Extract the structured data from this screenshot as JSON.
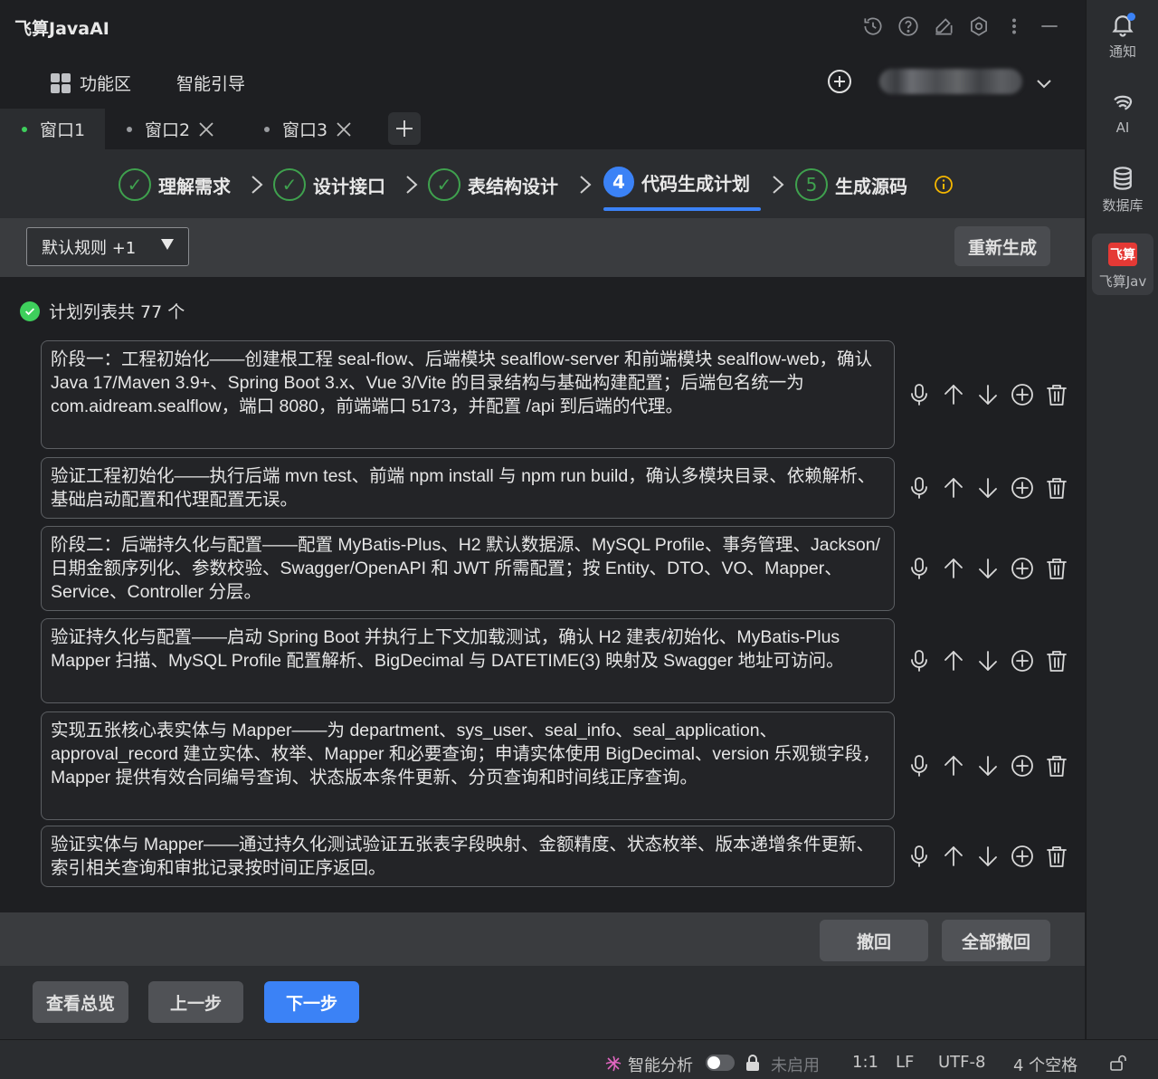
{
  "app": {
    "title": "飞算JavaAI"
  },
  "toolbar": {
    "func_label": "功能区",
    "guide_label": "智能引导"
  },
  "tabs": [
    {
      "label": "窗口1",
      "active": true
    },
    {
      "label": "窗口2",
      "closable": true
    },
    {
      "label": "窗口3",
      "closable": true
    }
  ],
  "steps": [
    {
      "num": "✓",
      "label": "理解需求",
      "state": "done"
    },
    {
      "num": "✓",
      "label": "设计接口",
      "state": "done"
    },
    {
      "num": "✓",
      "label": "表结构设计",
      "state": "done"
    },
    {
      "num": "4",
      "label": "代码生成计划",
      "state": "current"
    },
    {
      "num": "5",
      "label": "生成源码",
      "state": "todo"
    }
  ],
  "filter": {
    "rules_label": "默认规则 +1",
    "regenerate_label": "重新生成"
  },
  "plan": {
    "count_text": "计划列表共 77 个",
    "items": [
      {
        "text": "阶段一：工程初始化——创建根工程 seal-flow、后端模块 sealflow-server 和前端模块 sealflow-web，确认 Java 17/Maven 3.9+、Spring Boot 3.x、Vue 3/Vite 的目录结构与基础构建配置；后端包名统一为 com.aidream.sealflow，端口 8080，前端端口 5173，并配置 /api 到后端的代理。"
      },
      {
        "text": "验证工程初始化——执行后端 mvn test、前端 npm install 与 npm run build，确认多模块目录、依赖解析、基础启动配置和代理配置无误。"
      },
      {
        "text": "阶段二：后端持久化与配置——配置 MyBatis-Plus、H2 默认数据源、MySQL Profile、事务管理、Jackson/日期金额序列化、参数校验、Swagger/OpenAPI 和 JWT 所需配置；按 Entity、DTO、VO、Mapper、Service、Controller 分层。"
      },
      {
        "text": "验证持久化与配置——启动 Spring Boot 并执行上下文加载测试，确认 H2 建表/初始化、MyBatis-Plus Mapper 扫描、MySQL Profile 配置解析、BigDecimal 与 DATETIME(3) 映射及 Swagger 地址可访问。"
      },
      {
        "text": "实现五张核心表实体与 Mapper——为 department、sys_user、seal_info、seal_application、approval_record 建立实体、枚举、Mapper 和必要查询；申请实体使用 BigDecimal、version 乐观锁字段，Mapper 提供有效合同编号查询、状态版本条件更新、分页查询和时间线正序查询。"
      },
      {
        "text": "验证实体与 Mapper——通过持久化测试验证五张表字段映射、金额精度、状态枚举、版本递增条件更新、索引相关查询和审批记录按时间正序返回。"
      }
    ]
  },
  "actions": {
    "undo_label": "撤回",
    "undo_all_label": "全部撤回"
  },
  "footer": {
    "overview_label": "查看总览",
    "prev_label": "上一步",
    "next_label": "下一步"
  },
  "status": {
    "ai_label": "智能分析",
    "disabled_label": "未启用",
    "position": "1:1",
    "line_ending": "LF",
    "encoding": "UTF-8",
    "indent": "4 个空格"
  },
  "rightbar": {
    "notify_label": "通知",
    "ai_label": "AI",
    "db_label": "数据库",
    "plugin_label": "飞算Jav",
    "logo_text": "飞算"
  },
  "colors": {
    "accent": "#3b82f6",
    "success": "#3ecf5c",
    "bg": "#1e1f22",
    "panel": "#2b2d30"
  }
}
